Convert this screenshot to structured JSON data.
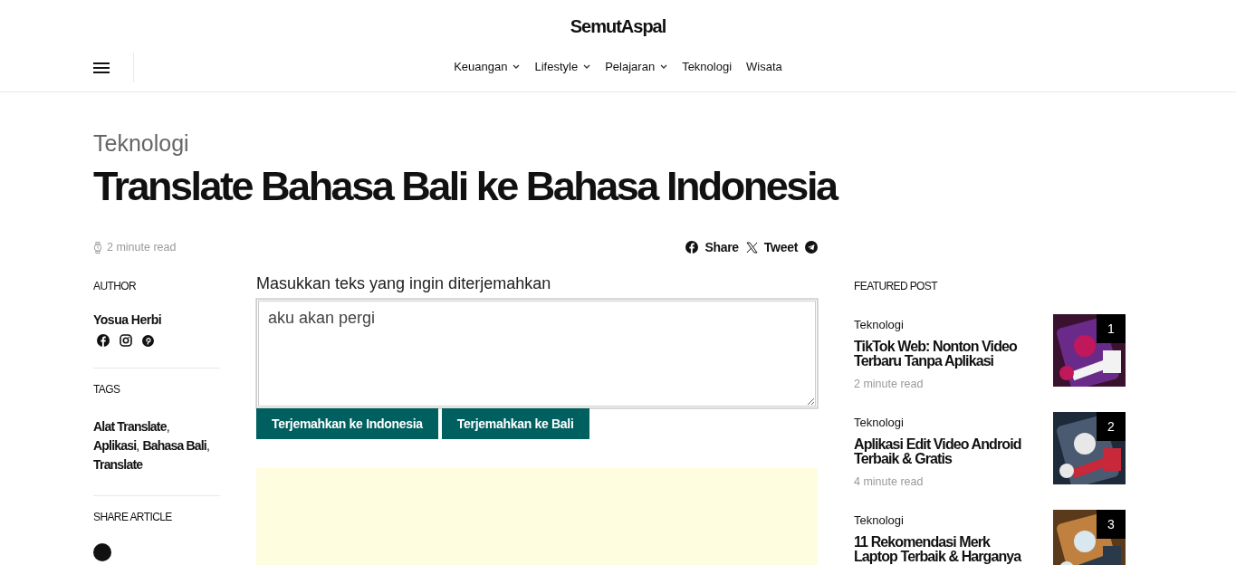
{
  "site": {
    "logo": "SemutAspal"
  },
  "nav": [
    {
      "label": "Keuangan",
      "has_dropdown": true
    },
    {
      "label": "Lifestyle",
      "has_dropdown": true
    },
    {
      "label": "Pelajaran",
      "has_dropdown": true
    },
    {
      "label": "Teknologi",
      "has_dropdown": false
    },
    {
      "label": "Wisata",
      "has_dropdown": false
    }
  ],
  "article": {
    "category": "Teknologi",
    "title": "Translate Bahasa Bali ke Bahasa Indonesia",
    "read_time": "2 minute read",
    "share": [
      {
        "kind": "facebook",
        "label": "Share"
      },
      {
        "kind": "x",
        "label": "Tweet"
      },
      {
        "kind": "telegram"
      }
    ]
  },
  "author": {
    "heading": "AUTHOR",
    "name": "Yosua Herbi",
    "socials": [
      {
        "kind": "facebook"
      },
      {
        "kind": "instagram"
      },
      {
        "kind": "pinterest"
      }
    ]
  },
  "tags": {
    "heading": "TAGS",
    "items": [
      {
        "label": "Alat Translate",
        "separator": ","
      },
      {
        "label": "Aplikasi",
        "separator": ","
      },
      {
        "label": "Bahasa Bali",
        "separator": ","
      },
      {
        "label": "Translate"
      }
    ]
  },
  "share_article": {
    "heading": "SHARE ARTICLE"
  },
  "translator": {
    "label": "Masukkan teks yang ingin diterjemahkan",
    "value": "aku akan pergi",
    "buttons": [
      "Terjemahkan ke Indonesia",
      "Terjemahkan ke Bali"
    ]
  },
  "featured": {
    "heading": "FEATURED POST",
    "posts": [
      {
        "category": "Teknologi",
        "title": "TikTok Web: Nonton Video Terbaru Tanpa Aplikasi",
        "read_time": "2 minute read",
        "rank": "1",
        "kind": "picture"
      },
      {
        "category": "Teknologi",
        "title": "Aplikasi Edit Video Android Terbaik & Gratis",
        "read_time": "4 minute read",
        "rank": "2",
        "kind": "picture"
      },
      {
        "category": "Teknologi",
        "title": "11 Rekomendasi Merk Laptop Terbaik & Harganya",
        "rank": "3",
        "kind": "picture"
      }
    ]
  }
}
